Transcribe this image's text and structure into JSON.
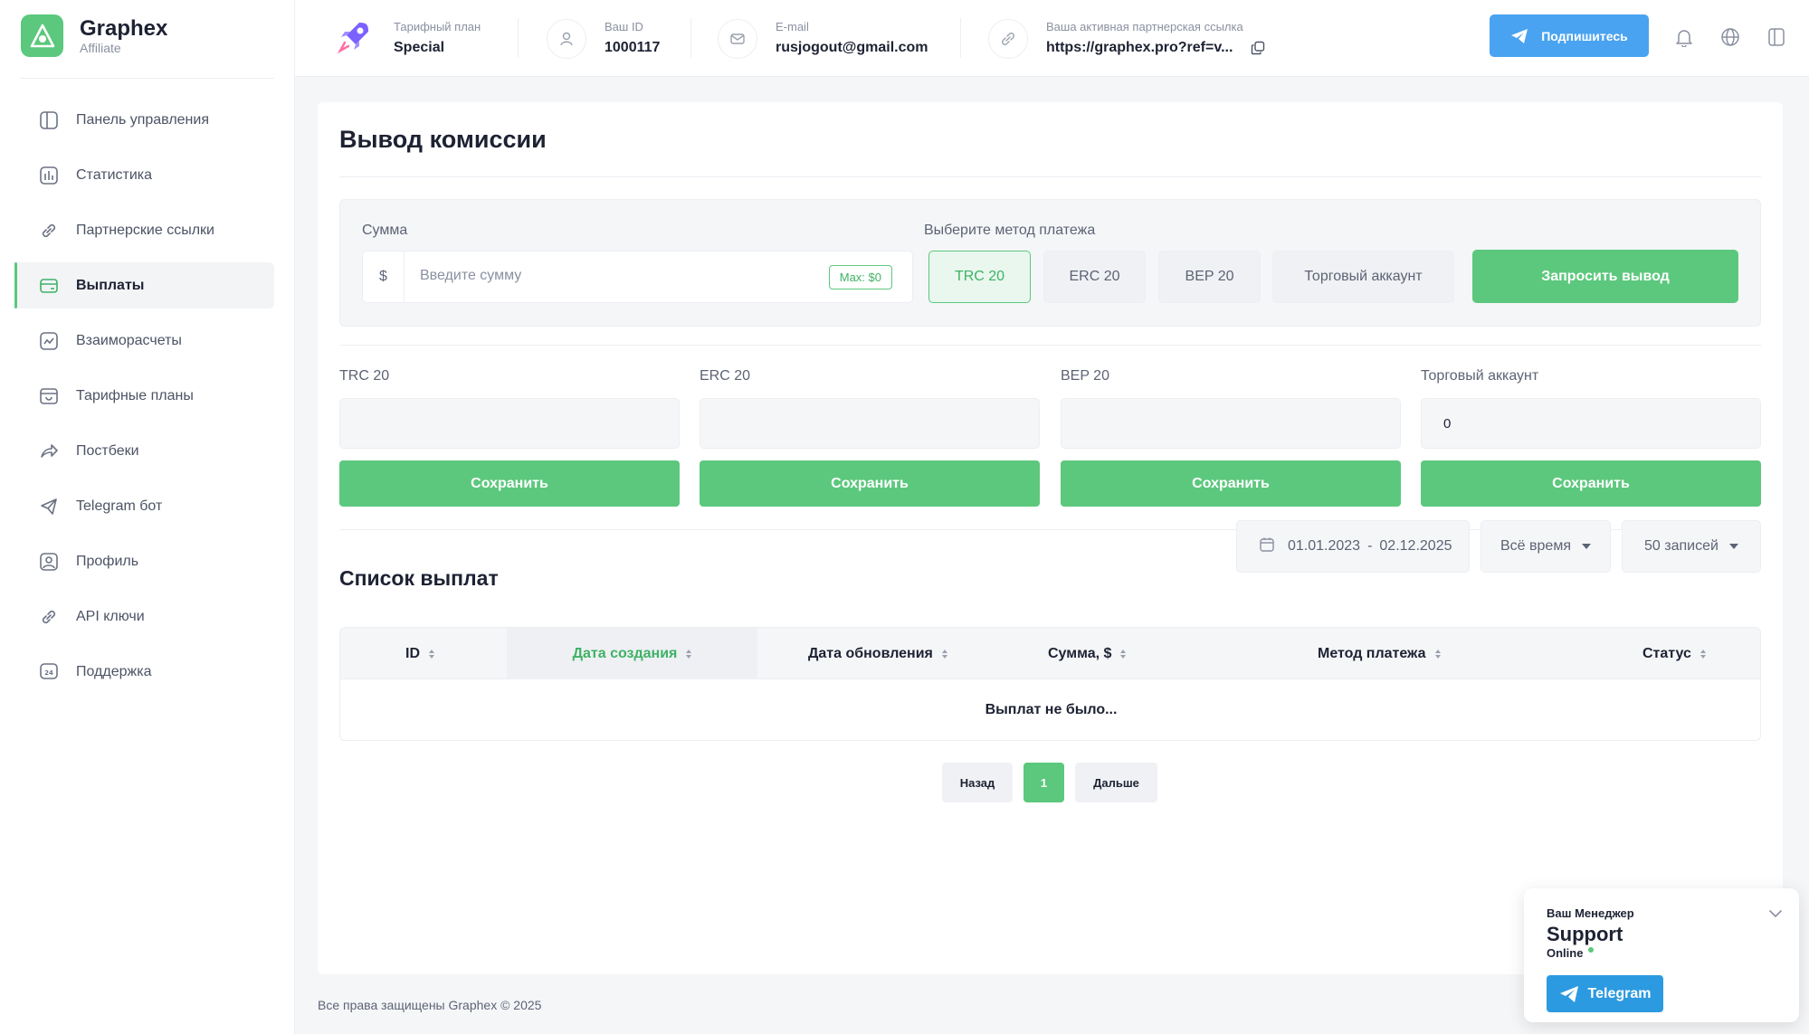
{
  "brand": {
    "name": "Graphex",
    "sub": "Affiliate"
  },
  "sidebar": {
    "items": [
      {
        "label": "Панель управления",
        "icon": "dashboard-icon"
      },
      {
        "label": "Статистика",
        "icon": "stats-icon"
      },
      {
        "label": "Партнерские ссылки",
        "icon": "link-icon"
      },
      {
        "label": "Выплаты",
        "icon": "payouts-icon",
        "active": true
      },
      {
        "label": "Взаиморасчеты",
        "icon": "settlements-icon"
      },
      {
        "label": "Тарифные планы",
        "icon": "plans-icon"
      },
      {
        "label": "Постбеки",
        "icon": "postback-icon"
      },
      {
        "label": "Telegram бот",
        "icon": "telegram-icon"
      },
      {
        "label": "Профиль",
        "icon": "profile-icon"
      },
      {
        "label": "API ключи",
        "icon": "api-key-icon"
      },
      {
        "label": "Поддержка",
        "icon": "support-icon"
      }
    ]
  },
  "header": {
    "plan": {
      "label": "Тарифный план",
      "value": "Special"
    },
    "user_id": {
      "label": "Ваш ID",
      "value": "1000117"
    },
    "email": {
      "label": "E-mail",
      "value": "rusjogout@gmail.com"
    },
    "ref": {
      "label": "Ваша активная партнерская ссылка",
      "value": "https://graphex.pro?ref=v..."
    },
    "subscribe_label": "Подпишитесь"
  },
  "main": {
    "title": "Вывод комиссии",
    "amount": {
      "label": "Сумма",
      "currency": "$",
      "placeholder": "Введите сумму",
      "max": "Max: $0"
    },
    "method_label": "Выберите метод платежа",
    "methods": [
      "TRC 20",
      "ERC 20",
      "BEP 20",
      "Торговый аккаунт"
    ],
    "selected_method": "TRC 20",
    "request_label": "Запросить вывод",
    "wallets": [
      {
        "label": "TRC 20",
        "value": ""
      },
      {
        "label": "ERC 20",
        "value": ""
      },
      {
        "label": "BEP 20",
        "value": ""
      },
      {
        "label": "Торговый аккаунт",
        "value": "0"
      }
    ],
    "save_label": "Сохранить",
    "list_title": "Список выплат",
    "date_from": "01.01.2023",
    "date_sep": "-",
    "date_to": "02.12.2025",
    "period": "Всё время",
    "per_page": "50 записей",
    "columns": [
      "ID",
      "Дата создания",
      "Дата обновления",
      "Сумма, $",
      "Метод платежа",
      "Статус"
    ],
    "sorted_column": "Дата создания",
    "empty_text": "Выплат не было...",
    "pagination": {
      "prev": "Назад",
      "current": "1",
      "next": "Дальше"
    }
  },
  "footer": {
    "text": "Все права защищены Graphex © 2025"
  },
  "manager": {
    "label": "Ваш Менеджер",
    "name": "Support",
    "status": "Online",
    "button": "Telegram"
  },
  "colors": {
    "accent": "#5cc87d",
    "telegram": "#2c9ae0",
    "subscribe": "#4aa3f0"
  }
}
